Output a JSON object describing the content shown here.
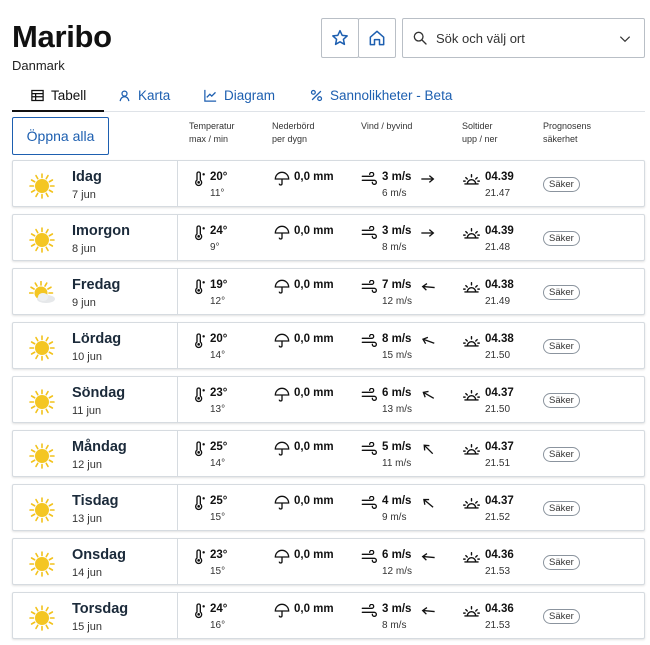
{
  "location": {
    "name": "Maribo",
    "country": "Danmark"
  },
  "search": {
    "placeholder": "Sök och välj ort"
  },
  "tabs": [
    {
      "label": "Tabell",
      "icon": "table-icon",
      "active": true
    },
    {
      "label": "Karta",
      "icon": "map-pin-icon",
      "active": false
    },
    {
      "label": "Diagram",
      "icon": "line-chart-icon",
      "active": false
    },
    {
      "label": "Sannolikheter - Beta",
      "icon": "percent-icon",
      "active": false
    }
  ],
  "open_all_label": "Öppna alla",
  "columns": {
    "temp": [
      "Temperatur",
      "max / min"
    ],
    "precip": [
      "Nederbörd",
      "per dygn"
    ],
    "wind": [
      "Vind / byvind"
    ],
    "sun": [
      "Soltider",
      "upp / ner"
    ],
    "certainty": [
      "Prognosens",
      "säkerhet"
    ]
  },
  "colors": {
    "accent": "#1d5fb0",
    "sun": "#f2c21b",
    "border": "#d6dbe0"
  },
  "days": [
    {
      "day": "Idag",
      "date": "7 jun",
      "icon": "sun-icon",
      "tmax": "20°",
      "tmin": "11°",
      "precip": "0,0 mm",
      "wind": "3 m/s",
      "gust": "6 m/s",
      "wind_dir_deg": 0,
      "sunrise": "04.39",
      "sunset": "21.47",
      "certainty": "Säker"
    },
    {
      "day": "Imorgon",
      "date": "8 jun",
      "icon": "sun-icon",
      "tmax": "24°",
      "tmin": "9°",
      "precip": "0,0 mm",
      "wind": "3 m/s",
      "gust": "8 m/s",
      "wind_dir_deg": 0,
      "sunrise": "04.39",
      "sunset": "21.48",
      "certainty": "Säker"
    },
    {
      "day": "Fredag",
      "date": "9 jun",
      "icon": "sun-cloud-icon",
      "tmax": "19°",
      "tmin": "12°",
      "precip": "0,0 mm",
      "wind": "7 m/s",
      "gust": "12 m/s",
      "wind_dir_deg": 185,
      "sunrise": "04.38",
      "sunset": "21.49",
      "certainty": "Säker"
    },
    {
      "day": "Lördag",
      "date": "10 jun",
      "icon": "sun-icon",
      "tmax": "20°",
      "tmin": "14°",
      "precip": "0,0 mm",
      "wind": "8 m/s",
      "gust": "15 m/s",
      "wind_dir_deg": 200,
      "sunrise": "04.38",
      "sunset": "21.50",
      "certainty": "Säker"
    },
    {
      "day": "Söndag",
      "date": "11 jun",
      "icon": "sun-icon",
      "tmax": "23°",
      "tmin": "13°",
      "precip": "0,0 mm",
      "wind": "6 m/s",
      "gust": "13 m/s",
      "wind_dir_deg": 210,
      "sunrise": "04.37",
      "sunset": "21.50",
      "certainty": "Säker"
    },
    {
      "day": "Måndag",
      "date": "12 jun",
      "icon": "sun-icon",
      "tmax": "25°",
      "tmin": "14°",
      "precip": "0,0 mm",
      "wind": "5 m/s",
      "gust": "11 m/s",
      "wind_dir_deg": 225,
      "sunrise": "04.37",
      "sunset": "21.51",
      "certainty": "Säker"
    },
    {
      "day": "Tisdag",
      "date": "13 jun",
      "icon": "sun-icon",
      "tmax": "25°",
      "tmin": "15°",
      "precip": "0,0 mm",
      "wind": "4 m/s",
      "gust": "9 m/s",
      "wind_dir_deg": 220,
      "sunrise": "04.37",
      "sunset": "21.52",
      "certainty": "Säker"
    },
    {
      "day": "Onsdag",
      "date": "14 jun",
      "icon": "sun-icon",
      "tmax": "23°",
      "tmin": "15°",
      "precip": "0,0 mm",
      "wind": "6 m/s",
      "gust": "12 m/s",
      "wind_dir_deg": 185,
      "sunrise": "04.36",
      "sunset": "21.53",
      "certainty": "Säker"
    },
    {
      "day": "Torsdag",
      "date": "15 jun",
      "icon": "sun-icon",
      "tmax": "24°",
      "tmin": "16°",
      "precip": "0,0 mm",
      "wind": "3 m/s",
      "gust": "8 m/s",
      "wind_dir_deg": 185,
      "sunrise": "04.36",
      "sunset": "21.53",
      "certainty": "Säker"
    }
  ]
}
